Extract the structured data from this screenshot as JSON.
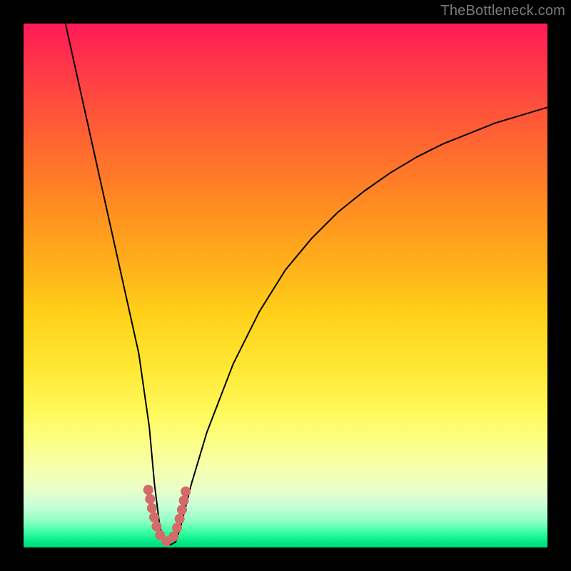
{
  "watermark": "TheBottleneck.com",
  "chart_data": {
    "type": "line",
    "title": "",
    "xlabel": "",
    "ylabel": "",
    "xlim": [
      0,
      100
    ],
    "ylim": [
      0,
      100
    ],
    "grid": false,
    "legend": false,
    "background_gradient": {
      "top_color": "#ff1a58",
      "mid_color": "#ffd21a",
      "bottom_color": "#00d878"
    },
    "series": [
      {
        "name": "bottleneck-curve",
        "color": "#000000",
        "type": "line",
        "x": [
          8,
          10,
          12,
          14,
          16,
          18,
          20,
          22,
          24,
          25,
          26,
          27,
          28,
          29,
          30,
          32,
          35,
          40,
          45,
          50,
          55,
          60,
          65,
          70,
          75,
          80,
          85,
          90,
          95,
          100
        ],
        "y": [
          100,
          91,
          82,
          73,
          64,
          55,
          46,
          37,
          23,
          12,
          4,
          1,
          0.5,
          1,
          4,
          12,
          22,
          35,
          45,
          53,
          59,
          64,
          68,
          71.5,
          74.5,
          77,
          79,
          81,
          82.5,
          84
        ]
      },
      {
        "name": "highlight-band",
        "color": "#d46a6a",
        "type": "line",
        "x": [
          23.8,
          24.6,
          25.4,
          26.2,
          27.0,
          27.8,
          28.6,
          29.4,
          30.2,
          31.0
        ],
        "y": [
          11.0,
          7.0,
          4.0,
          2.0,
          1.2,
          1.2,
          2.0,
          4.0,
          7.0,
          11.0
        ]
      }
    ]
  }
}
